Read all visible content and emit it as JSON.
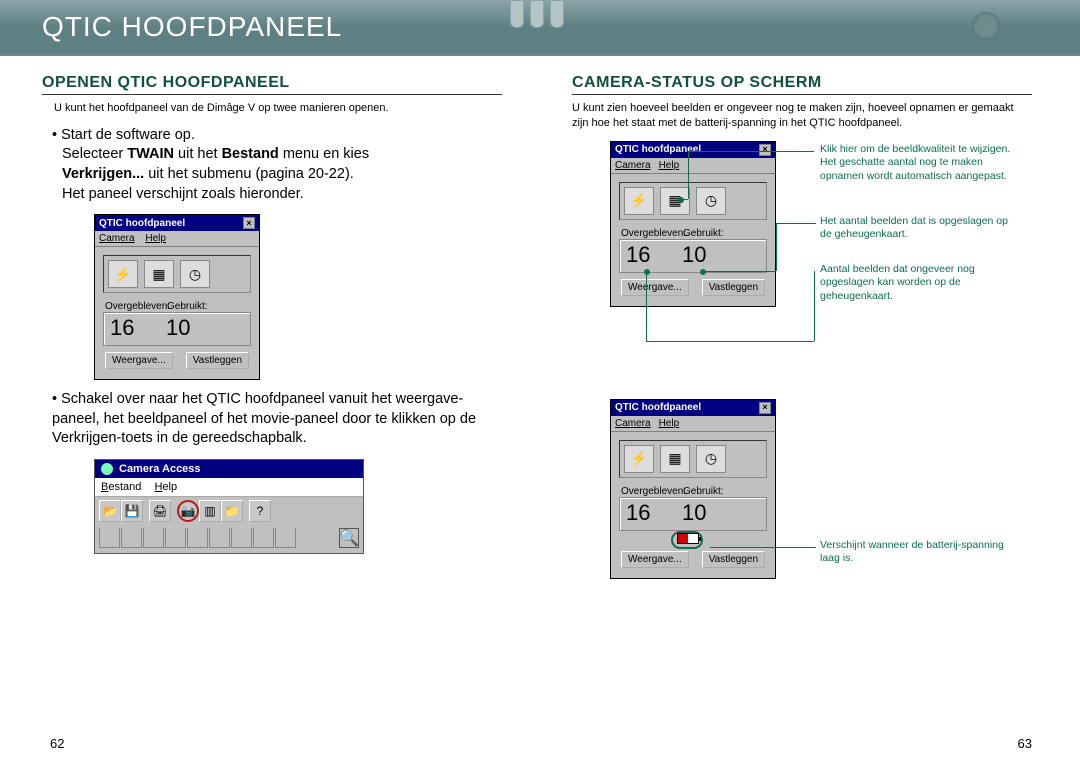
{
  "topbar": {
    "title": "QTIC HOOFDPANEEL"
  },
  "left": {
    "section_title": "OPENEN QTIC HOOFDPANEEL",
    "intro": "U kunt het hoofdpaneel van de Dimâge V op twee manieren openen.",
    "body1_line1": "• Start de software op.",
    "body1_line2a": "Selecteer ",
    "body1_twain": "TWAIN",
    "body1_line2b": " uit het ",
    "body1_bestand": "Bestand",
    "body1_line2c": " menu en kies",
    "body1_line3a": "Verkrijgen...",
    "body1_line3b": " uit het submenu (pagina 20-22).",
    "body1_line4": "Het paneel verschijnt zoals hieronder.",
    "body2": "• Schakel over naar het QTIC hoofdpaneel  vanuit het weergave-paneel, het beeldpaneel of het movie-paneel door te klikken op de Verkrijgen-toets in de gereedschapbalk."
  },
  "right": {
    "section_title": "CAMERA-STATUS OP SCHERM",
    "intro": "U kunt zien hoeveel beelden er ongeveer nog te maken zijn, hoeveel opnamen er gemaakt zijn hoe het staat met de batterij-spanning in het QTIC hoofdpaneel.",
    "anno1": "Klik hier om de beeldkwaliteit te wijzigen. Het geschatte aantal nog te maken opnamen wordt automatisch aangepast.",
    "anno2": "Het aantal beelden dat is opgeslagen op de geheugenkaart.",
    "anno3": "Aantal beelden dat ongeveer nog opgeslagen kan worden op de geheugenkaart.",
    "anno4": "Verschijnt wanneer de batterij-spanning laag is."
  },
  "panel": {
    "title": "QTIC hoofdpaneel",
    "menu_camera": "Camera",
    "menu_help": "Help",
    "lbl_over": "Overgebleven:",
    "lbl_used": "Gebruikt:",
    "val_over": "16",
    "val_used": "10",
    "btn_weergave": "Weergave...",
    "btn_vastleggen": "Vastleggen"
  },
  "camacc": {
    "title": "Camera Access",
    "menu_bestand": "Bestand",
    "menu_help": "Help"
  },
  "pagenums": {
    "left": "62",
    "right": "63"
  }
}
